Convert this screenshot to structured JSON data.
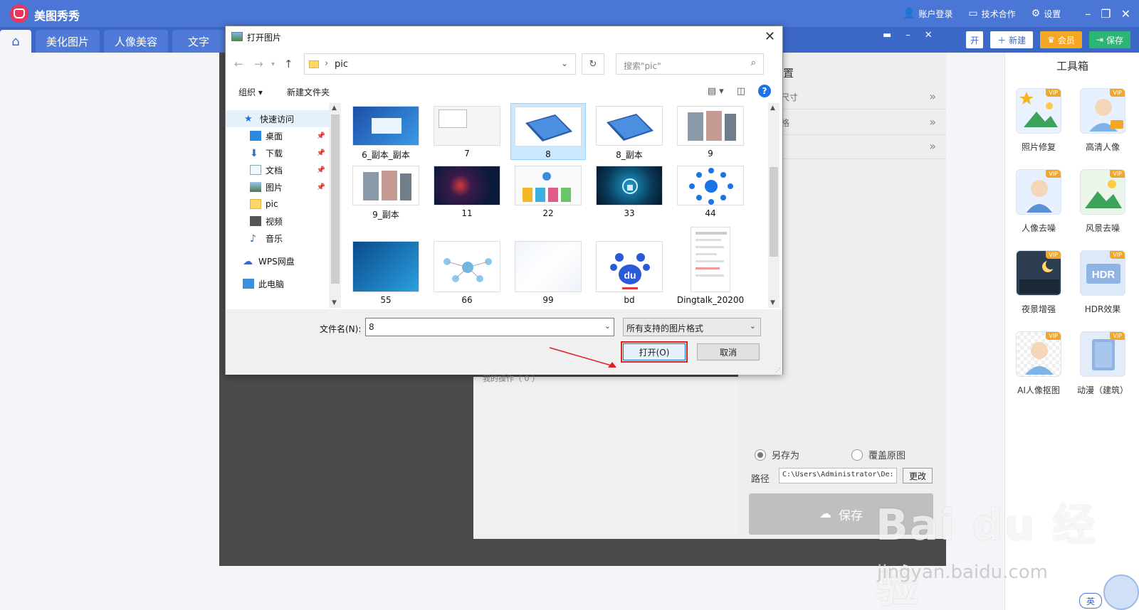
{
  "app": {
    "title": "美图秀秀",
    "top_links": [
      "账户登录",
      "技术合作",
      "设置"
    ],
    "nav_tabs": [
      "美化图片",
      "人像美容",
      "文字"
    ],
    "nav_buttons": {
      "open": "开",
      "new": "新建",
      "vip": "会员",
      "save": "保存"
    }
  },
  "toolbox": {
    "title": "工具箱",
    "tools": [
      {
        "label": "照片修复",
        "badge": "VIP"
      },
      {
        "label": "高清人像",
        "badge": "VIP"
      },
      {
        "label": "人像去噪",
        "badge": "VIP"
      },
      {
        "label": "风景去噪",
        "badge": "VIP"
      },
      {
        "label": "夜景增强",
        "badge": "VIP"
      },
      {
        "label": "HDR效果",
        "badge": "VIP"
      },
      {
        "label": "AI人像抠图",
        "badge": "VIP"
      },
      {
        "label": "动漫（建筑）",
        "badge": "VIP"
      }
    ]
  },
  "editor": {
    "settings_head": "置",
    "rows": [
      "尺寸",
      "格",
      ""
    ],
    "ops_title": "我的操作（ 0 ）",
    "save_as": "另存为",
    "overwrite": "覆盖原图",
    "path_label": "路径",
    "path_value": "C:\\Users\\Administrator\\De:",
    "change_btn": "更改",
    "save_btn": "保存"
  },
  "dialog": {
    "title": "打开图片",
    "address": "pic",
    "search_placeholder": "搜索\"pic\"",
    "organize": "组织 ▾",
    "new_folder": "新建文件夹",
    "nav": [
      {
        "label": "快速访问",
        "icon": "star-icon"
      },
      {
        "label": "桌面",
        "icon": "desktop-icon"
      },
      {
        "label": "下载",
        "icon": "download-icon"
      },
      {
        "label": "文档",
        "icon": "document-icon"
      },
      {
        "label": "图片",
        "icon": "picture-icon"
      },
      {
        "label": "pic",
        "icon": "folder-icon"
      },
      {
        "label": "视频",
        "icon": "video-icon"
      },
      {
        "label": "音乐",
        "icon": "music-icon"
      },
      {
        "label": "WPS网盘",
        "icon": "cloud-icon"
      },
      {
        "label": "此电脑",
        "icon": "computer-icon"
      }
    ],
    "files": [
      "6_副本_副本",
      "7",
      "8",
      "8_副本",
      "9",
      "9_副本",
      "11",
      "22",
      "33",
      "44",
      "55",
      "66",
      "99",
      "bd",
      "Dingtalk_20200"
    ],
    "selected_file": "8",
    "filename_label": "文件名(N):",
    "filename_value": "8",
    "filetype": "所有支持的图片格式",
    "open_btn": "打开(O)",
    "cancel_btn": "取消"
  },
  "watermark": {
    "main": "Bai du 经验",
    "sub": "jingyan.baidu.com"
  },
  "ime": "英",
  "colors": {
    "brand": "#4a76d6",
    "nav": "#3c68c8",
    "vip": "#f5a623",
    "save": "#2bb673",
    "highlight": "#e02020"
  }
}
